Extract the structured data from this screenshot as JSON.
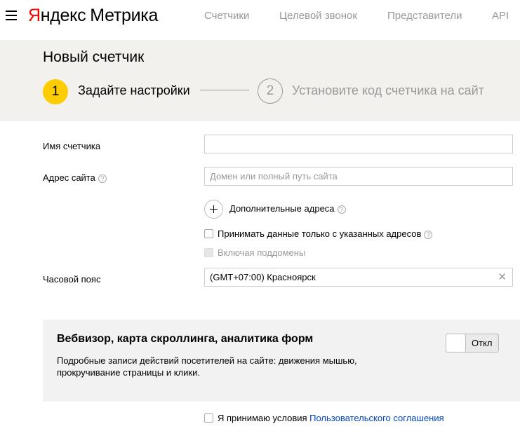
{
  "topbar": {
    "logo_brand_first": "Я",
    "logo_brand_rest": "ндекс",
    "logo_product": "Метрика",
    "nav": [
      "Счетчики",
      "Целевой звонок",
      "Представители",
      "API"
    ]
  },
  "header": {
    "title": "Новый счетчик",
    "step1_number": "1",
    "step1_label": "Задайте настройки",
    "step2_number": "2",
    "step2_label": "Установите код счетчика на сайт"
  },
  "form": {
    "counter_name_label": "Имя счетчика",
    "counter_name_value": "",
    "site_address_label": "Адрес сайта",
    "site_address_placeholder": "Домен или полный путь сайта",
    "additional_addresses_label": "Дополнительные адреса",
    "accept_only_listed_label": "Принимать данные только с указанных адресов",
    "include_subdomains_label": "Включая поддомены",
    "timezone_label": "Часовой пояс",
    "timezone_value": "(GMT+07:00) Красноярск"
  },
  "webvisor": {
    "title": "Вебвизор, карта скроллинга, аналитика форм",
    "description": "Подробные записи действий посетителей на сайте: движения мышью, прокручивание страницы и клики.",
    "toggle_label": "Откл"
  },
  "agreement": {
    "prefix": "Я принимаю условия ",
    "link": "Пользовательского соглашения"
  },
  "colors": {
    "accent": "#ffcc00",
    "brand_red": "#ff0000",
    "link": "#0044bb",
    "band": "#f2f1ed"
  }
}
